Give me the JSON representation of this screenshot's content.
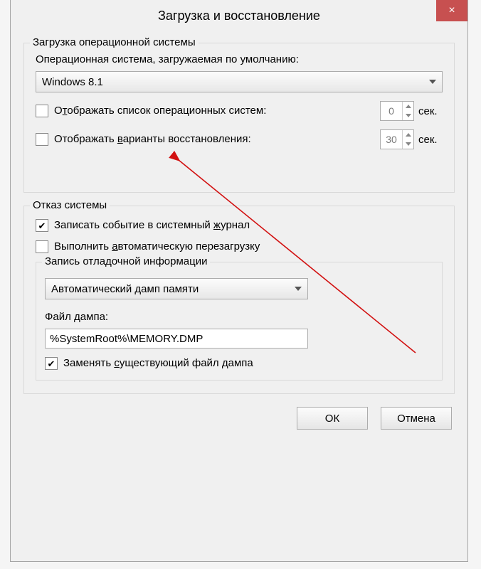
{
  "title": "Загрузка и восстановление",
  "close_label": "×",
  "startup": {
    "group_title": "Загрузка операционной системы",
    "default_label": "Операционная система, загружаемая по умолчанию:",
    "default_os": "Windows 8.1",
    "show_os_list_label_pre": "О",
    "show_os_list_label_ul": "т",
    "show_os_list_label_post": "ображать список операционных систем:",
    "show_os_list_value": "0",
    "show_os_list_unit": "сек.",
    "show_recovery_label_pre": "Отображать ",
    "show_recovery_label_ul": "в",
    "show_recovery_label_post": "арианты восстановления:",
    "show_recovery_value": "30",
    "show_recovery_unit": "сек."
  },
  "failure": {
    "group_title": "Отказ системы",
    "log_label_pre": "Записать событие в системный ",
    "log_label_ul": "ж",
    "log_label_post": "урнал",
    "restart_label_pre": "Выполнить ",
    "restart_label_ul": "а",
    "restart_label_post": "втоматическую перезагрузку",
    "debug_title": "Запись отладочной информации",
    "dump_kind": "Автоматический дамп памяти",
    "dumpfile_label": "Файл дампа:",
    "dumpfile_value": "%SystemRoot%\\MEMORY.DMP",
    "overwrite_label_pre": "Заменять ",
    "overwrite_label_ul": "с",
    "overwrite_label_post": "уществующий файл дампа"
  },
  "buttons": {
    "ok": "ОК",
    "cancel": "Отмена"
  }
}
